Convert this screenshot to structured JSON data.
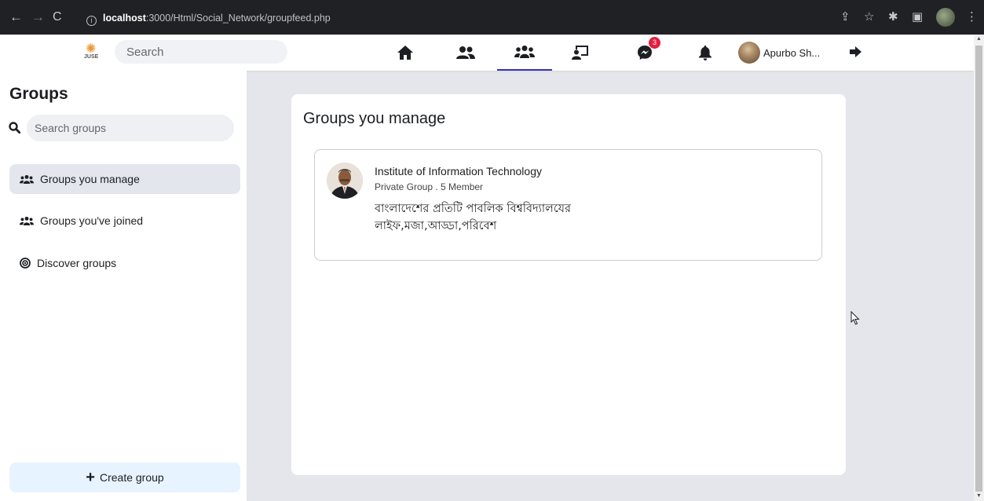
{
  "browser": {
    "url_host": "localhost",
    "url_rest": ":3000/Html/Social_Network/groupfeed.php"
  },
  "topbar": {
    "logo_text": "JUSE",
    "search_placeholder": "Search",
    "messenger_badge": "3",
    "profile_name": "Apurbo Sh..."
  },
  "sidebar": {
    "title": "Groups",
    "search_placeholder": "Search groups",
    "items": [
      {
        "label": "Groups you manage",
        "icon": "users-icon",
        "active": true
      },
      {
        "label": "Groups you've joined",
        "icon": "users-icon",
        "active": false
      },
      {
        "label": "Discover groups",
        "icon": "compass-icon",
        "active": false
      }
    ],
    "create_label": "Create group"
  },
  "main": {
    "heading": "Groups you manage",
    "groups": [
      {
        "name": "Institute of Information Technology",
        "meta": "Private Group . 5 Member",
        "description": "বাংলাদেশের প্রতিটি পাবলিক বিশ্ববিদ্যালযের লাইফ,মজা,আড্ডা,পরিবেশ"
      }
    ]
  },
  "colors": {
    "accent": "#3b2fb3",
    "badge": "#e41e3f",
    "create_bg": "#e7f3ff",
    "page_bg": "#e4e6eb"
  }
}
